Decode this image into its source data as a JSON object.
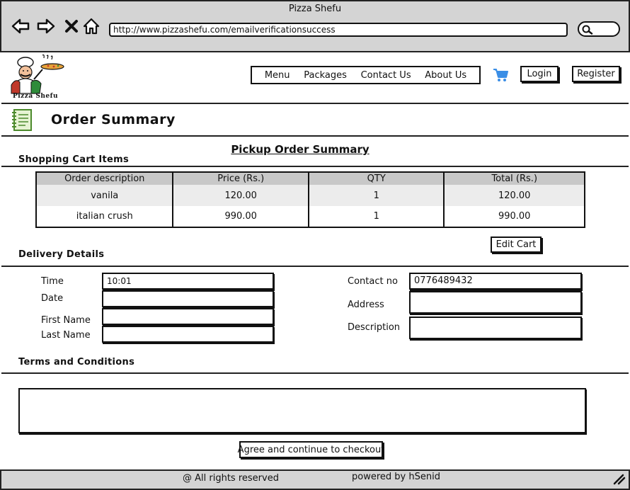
{
  "window": {
    "title": "Pizza Shefu"
  },
  "browser": {
    "url": "http://www.pizzashefu.com/emailverificationsuccess"
  },
  "logo": {
    "text": "Pizza Shefu"
  },
  "nav": {
    "items": [
      "Menu",
      "Packages",
      "Contact Us",
      "About Us"
    ]
  },
  "header": {
    "login_label": "Login",
    "register_label": "Register"
  },
  "page": {
    "title": "Order Summary",
    "subtitle": "Pickup Order Summary"
  },
  "cart": {
    "section_label": "Shopping Cart Items",
    "columns": [
      "Order description",
      "Price (Rs.)",
      "QTY",
      "Total (Rs.)"
    ],
    "rows": [
      [
        "vanila",
        "120.00",
        "1",
        "120.00"
      ],
      [
        "italian crush",
        "990.00",
        "1",
        "990.00"
      ]
    ],
    "edit_label": "Edit Cart"
  },
  "delivery": {
    "section_label": "Delivery Details",
    "time_label": "Time",
    "time_value": "10:01",
    "date_label": "Date",
    "date_value": "",
    "first_name_label": "First Name",
    "first_name_value": "",
    "last_name_label": "Last Name",
    "last_name_value": "",
    "contact_label": "Contact no",
    "contact_value": "0776489432",
    "address_label": "Address",
    "address_value": "",
    "description_label": "Description",
    "description_value": ""
  },
  "terms": {
    "section_label": "Terms and Conditions",
    "checkout_label": "Agree and continue to checkout"
  },
  "footer": {
    "rights": "@ All rights reserved",
    "powered": "powered by hSenid"
  },
  "colors": {
    "cart_icon": "#3a8ee6",
    "chrome_bg": "#d4d4d4",
    "table_header_bg": "#c8c8c8"
  },
  "icons": [
    "back-arrow-icon",
    "forward-arrow-icon",
    "close-icon",
    "home-icon",
    "search-icon",
    "shopping-cart-icon",
    "notepad-icon",
    "resize-grip-icon"
  ]
}
